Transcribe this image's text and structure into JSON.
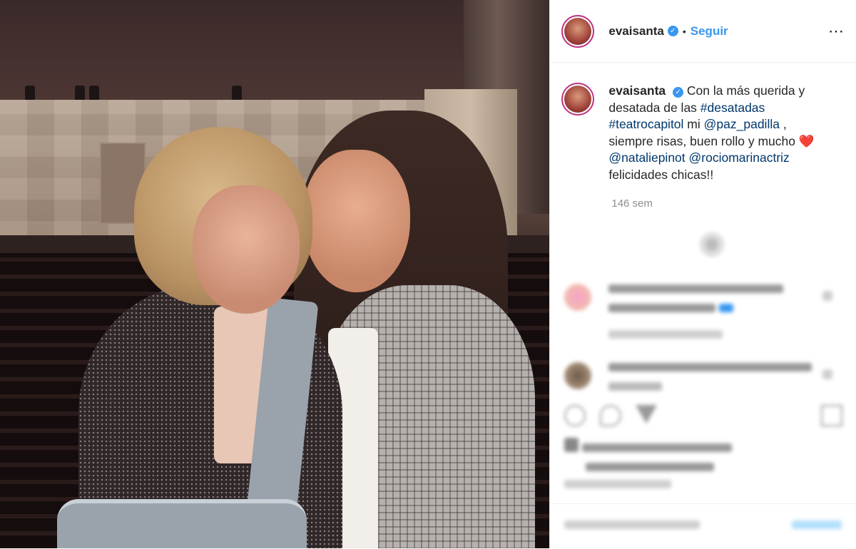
{
  "post": {
    "username": "evaisanta",
    "follow_label": "Seguir",
    "separator": "•",
    "more_icon": "⋯",
    "verified_icon": "✓",
    "caption_intro": "Con la más querida y desatada de las ",
    "tag1": "#desatadas",
    "tag2": "#teatrocapitol",
    "caption_mid": " mi ",
    "mention1": "@paz_padilla",
    "caption_after": " , siempre risas, buen rollo y mucho ",
    "heart": "❤️",
    "mention2": "@nataliepinot",
    "mention3": "@rociomarinactriz",
    "caption_end": "felicidades chicas!!",
    "time": "146 sem"
  },
  "colors": {
    "accent": "#3897f0",
    "link": "#00376b",
    "text": "#262626",
    "muted": "#8e8e8e"
  }
}
